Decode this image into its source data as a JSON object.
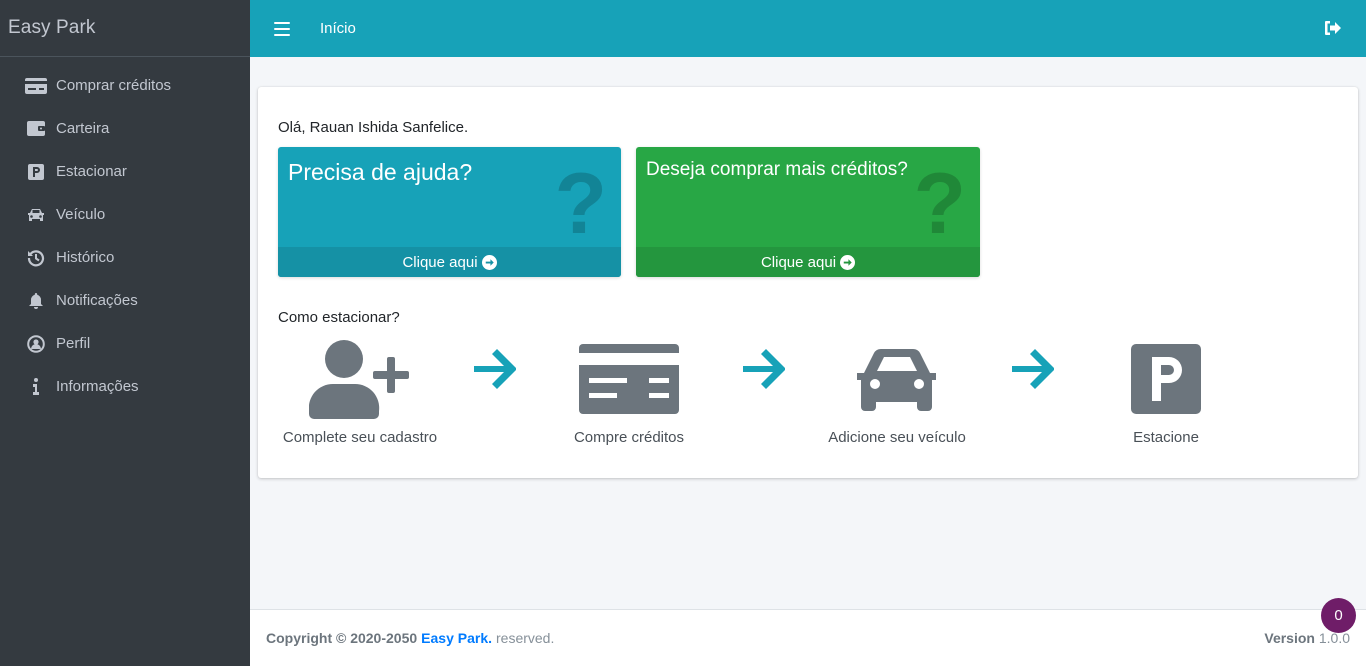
{
  "app": {
    "brand": "Easy Park"
  },
  "sidebar": {
    "items": [
      {
        "label": "Comprar créditos",
        "icon": "credit-card-icon"
      },
      {
        "label": "Carteira",
        "icon": "wallet-icon"
      },
      {
        "label": "Estacionar",
        "icon": "parking-icon"
      },
      {
        "label": "Veículo",
        "icon": "car-icon"
      },
      {
        "label": "Histórico",
        "icon": "history-icon"
      },
      {
        "label": "Notificações",
        "icon": "bell-icon"
      },
      {
        "label": "Perfil",
        "icon": "user-circle-icon"
      },
      {
        "label": "Informações",
        "icon": "info-icon"
      }
    ]
  },
  "topbar": {
    "home_label": "Início",
    "logout_icon": "sign-out-icon",
    "menu_icon": "hamburger-icon"
  },
  "main": {
    "greeting": "Olá, Rauan Ishida Sanfelice.",
    "help_box": {
      "title": "Precisa de ajuda?",
      "footer": "Clique aqui",
      "icon": "question-icon"
    },
    "credits_box": {
      "title": "Deseja comprar mais créditos?",
      "footer": "Clique aqui",
      "icon": "question-icon"
    },
    "how_title": "Como estacionar?",
    "steps": [
      {
        "caption": "Complete seu cadastro",
        "icon": "user-plus-icon"
      },
      {
        "caption": "Compre créditos",
        "icon": "credit-card-icon"
      },
      {
        "caption": "Adicione seu veículo",
        "icon": "car-icon"
      },
      {
        "caption": "Estacione",
        "icon": "parking-icon"
      }
    ]
  },
  "footer": {
    "copyright": "Copyright © 2020-2050",
    "brand": "Easy Park.",
    "reserved": "reserved.",
    "version_label": "Version",
    "version": "1.0.0"
  },
  "notification_badge": {
    "count": "0"
  },
  "colors": {
    "sidebar": "#343a40",
    "topbar": "#17a2b8",
    "info": "#17a2b8",
    "success": "#28a745",
    "icon_gray": "#6c757d",
    "badge": "#6f1d68"
  }
}
